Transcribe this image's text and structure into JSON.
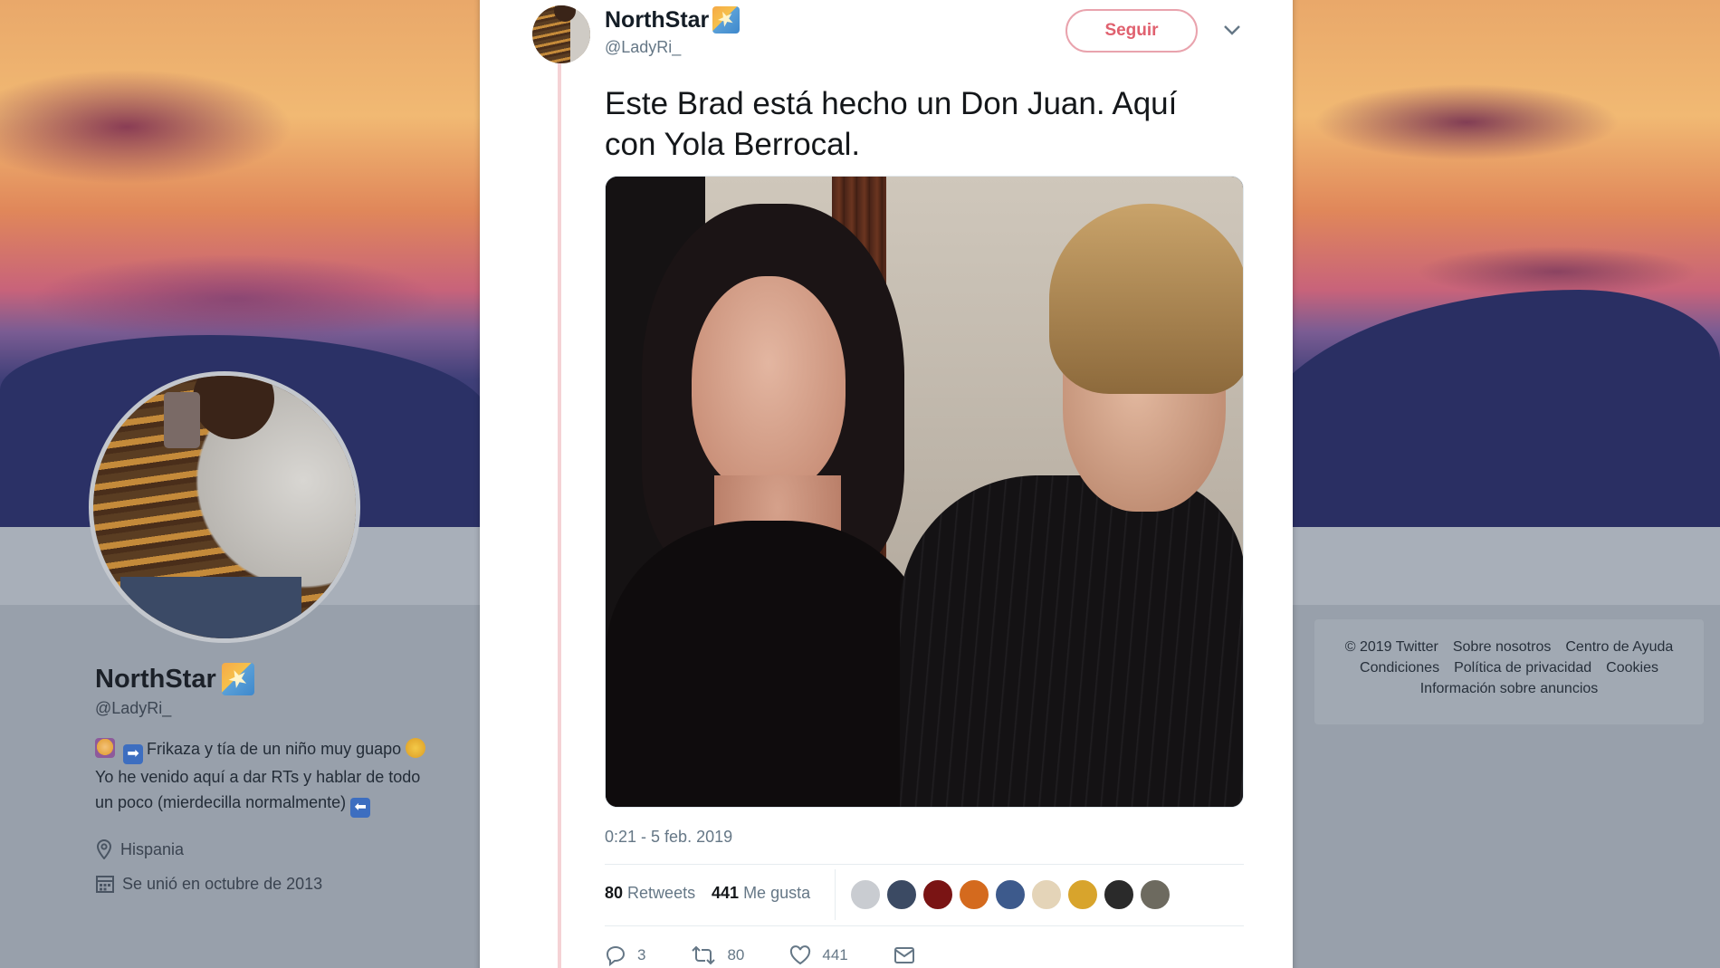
{
  "profile": {
    "name": "NorthStar",
    "handle": "@LadyRi_",
    "bio_line1": "Frikaza y tía de un niño muy guapo",
    "bio_line2": "Yo he venido aquí a dar RTs y hablar de todo",
    "bio_line3": "un poco (mierdecilla normalmente)",
    "location": "Hispania",
    "joined": "Se unió en octubre de 2013"
  },
  "footer": {
    "copyright": "© 2019 Twitter",
    "about": "Sobre nosotros",
    "help": "Centro de Ayuda",
    "terms": "Condiciones",
    "privacy": "Política de privacidad",
    "cookies": "Cookies",
    "ads_info": "Información sobre anuncios"
  },
  "tweet": {
    "author_name": "NorthStar",
    "author_handle": "@LadyRi_",
    "follow_label": "Seguir",
    "text_line1": "Este Brad está hecho un Don Juan. Aquí",
    "text_line2": "con Yola Berrocal.",
    "timestamp": "0:21 - 5 feb. 2019",
    "retweets_count": "80",
    "retweets_label": "Retweets",
    "likes_count": "441",
    "likes_label": "Me gusta",
    "reply_count": "3",
    "retweet_action_count": "80",
    "like_action_count": "441"
  },
  "likers": [
    {
      "color": "#c9ccd1"
    },
    {
      "color": "#3b4a63"
    },
    {
      "color": "#7a1414"
    },
    {
      "color": "#d46a1e"
    },
    {
      "color": "#3d5a8c"
    },
    {
      "color": "#e4d4b8"
    },
    {
      "color": "#d8a42c"
    },
    {
      "color": "#2a2a2a"
    },
    {
      "color": "#6d6a5f"
    }
  ],
  "colors": {
    "follow_accent": "#e0616f",
    "thread_line": "#f5d2d5",
    "muted_text": "#657786"
  }
}
